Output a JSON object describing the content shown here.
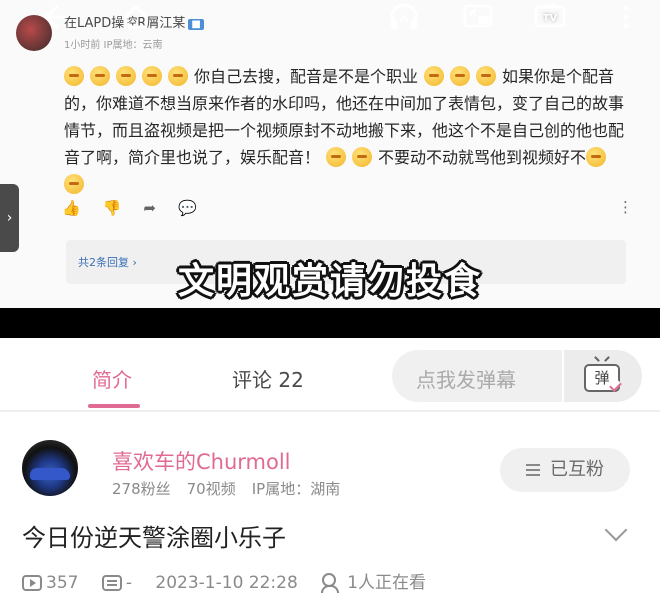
{
  "player": {
    "icons": [
      "back-arrow-icon",
      "headphones-icon",
      "picture-in-picture-icon",
      "tv-cast-icon",
      "more-vertical-icon"
    ],
    "comment": {
      "author": "在LAPD操控R屑江某",
      "author_tag": "■",
      "meta": "1小时前  IP属地：云南",
      "text_lines": [
        "你自己去搜，配音是不是个职业",
        "如果你是个配音的，你难道不想当原来作者的水印吗，他还在中间加了表情包，变了自己的故事情节，而且盗视频是把一个视频原封不动地搬下来，他这个不是自己创的他也配音了啊，简介里也说了，娱乐配音！",
        "不要动不动就骂他到视频好不"
      ],
      "replies_label": "共2条回复 ›"
    },
    "subtitle": "文明观赏请勿投食",
    "side_tab": "›"
  },
  "tabs": {
    "intro": "简介",
    "comments": "评论 22",
    "danmaku_placeholder": "点我发弹幕",
    "danmaku_button": "弹"
  },
  "uploader": {
    "name": "喜欢车的Churmoll",
    "fans": "278粉丝",
    "videos": "70视频",
    "ip": "IP属地：湖南",
    "follow_label": "已互粉"
  },
  "video": {
    "title": "今日份逆天警涂圈小乐子",
    "plays": "357",
    "danmaku_count": "-",
    "date": "2023-1-10 22:28",
    "watching": "1人正在看"
  },
  "colors": {
    "accent": "#e06a93",
    "link": "#3b6fb6"
  }
}
